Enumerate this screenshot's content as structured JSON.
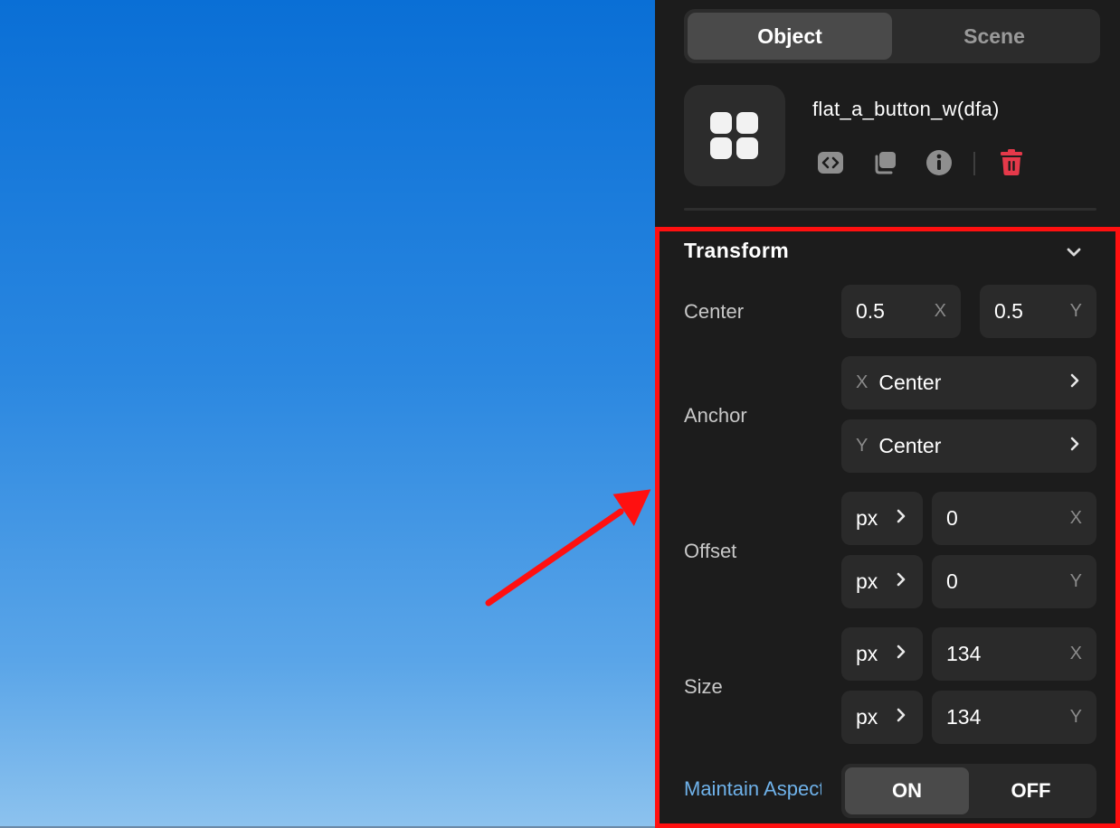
{
  "tabs": [
    {
      "label": "Object",
      "active": true
    },
    {
      "label": "Scene",
      "active": false
    }
  ],
  "object": {
    "name": "flat_a_button_w(dfa)",
    "icon": "grid-four-dots-icon",
    "tools": [
      "code-icon",
      "duplicate-icon",
      "info-icon",
      "trash-icon"
    ]
  },
  "transform": {
    "title": "Transform",
    "center": {
      "label": "Center",
      "x": "0.5",
      "x_axis": "X",
      "y": "0.5",
      "y_axis": "Y"
    },
    "anchor": {
      "label": "Anchor",
      "x_axis": "X",
      "x": "Center",
      "y_axis": "Y",
      "y": "Center"
    },
    "offset": {
      "label": "Offset",
      "unit_x": "px",
      "x": "0",
      "x_axis": "X",
      "unit_y": "px",
      "y": "0",
      "y_axis": "Y"
    },
    "size": {
      "label": "Size",
      "unit_x": "px",
      "x": "134",
      "x_axis": "X",
      "unit_y": "px",
      "y": "134",
      "y_axis": "Y"
    },
    "aspect": {
      "label": "Maintain Aspect",
      "on": "ON",
      "off": "OFF",
      "selected": "ON"
    }
  },
  "colors": {
    "accent_blue": "#6fb2ea",
    "delete_red": "#e5394a",
    "highlight": "#ff1010"
  }
}
